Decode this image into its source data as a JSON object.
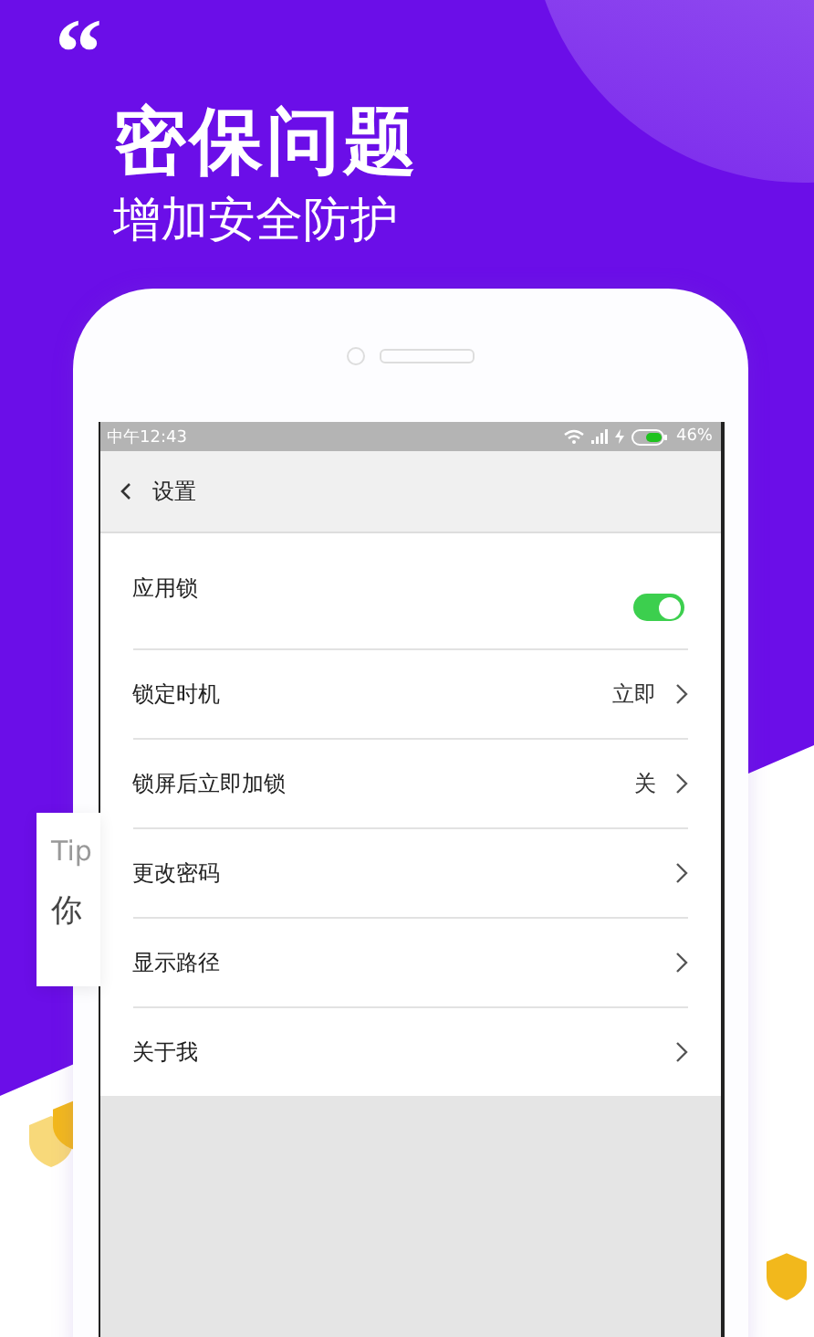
{
  "hero": {
    "quote_mark": "“",
    "title": "密保问题",
    "subtitle": "增加安全防护"
  },
  "tip_card": {
    "label": "Tip",
    "text": "你"
  },
  "status_bar": {
    "time": "中午12:43",
    "battery": "46%"
  },
  "header": {
    "title": "设置"
  },
  "settings": [
    {
      "kind": "toggle",
      "label": "应用锁",
      "on": true
    },
    {
      "kind": "link",
      "label": "锁定时机",
      "value": "立即"
    },
    {
      "kind": "link",
      "label": "锁屏后立即加锁",
      "value": "关"
    },
    {
      "kind": "link",
      "label": "更改密码"
    },
    {
      "kind": "link",
      "label": "显示路径"
    },
    {
      "kind": "link",
      "label": "关于我"
    }
  ]
}
